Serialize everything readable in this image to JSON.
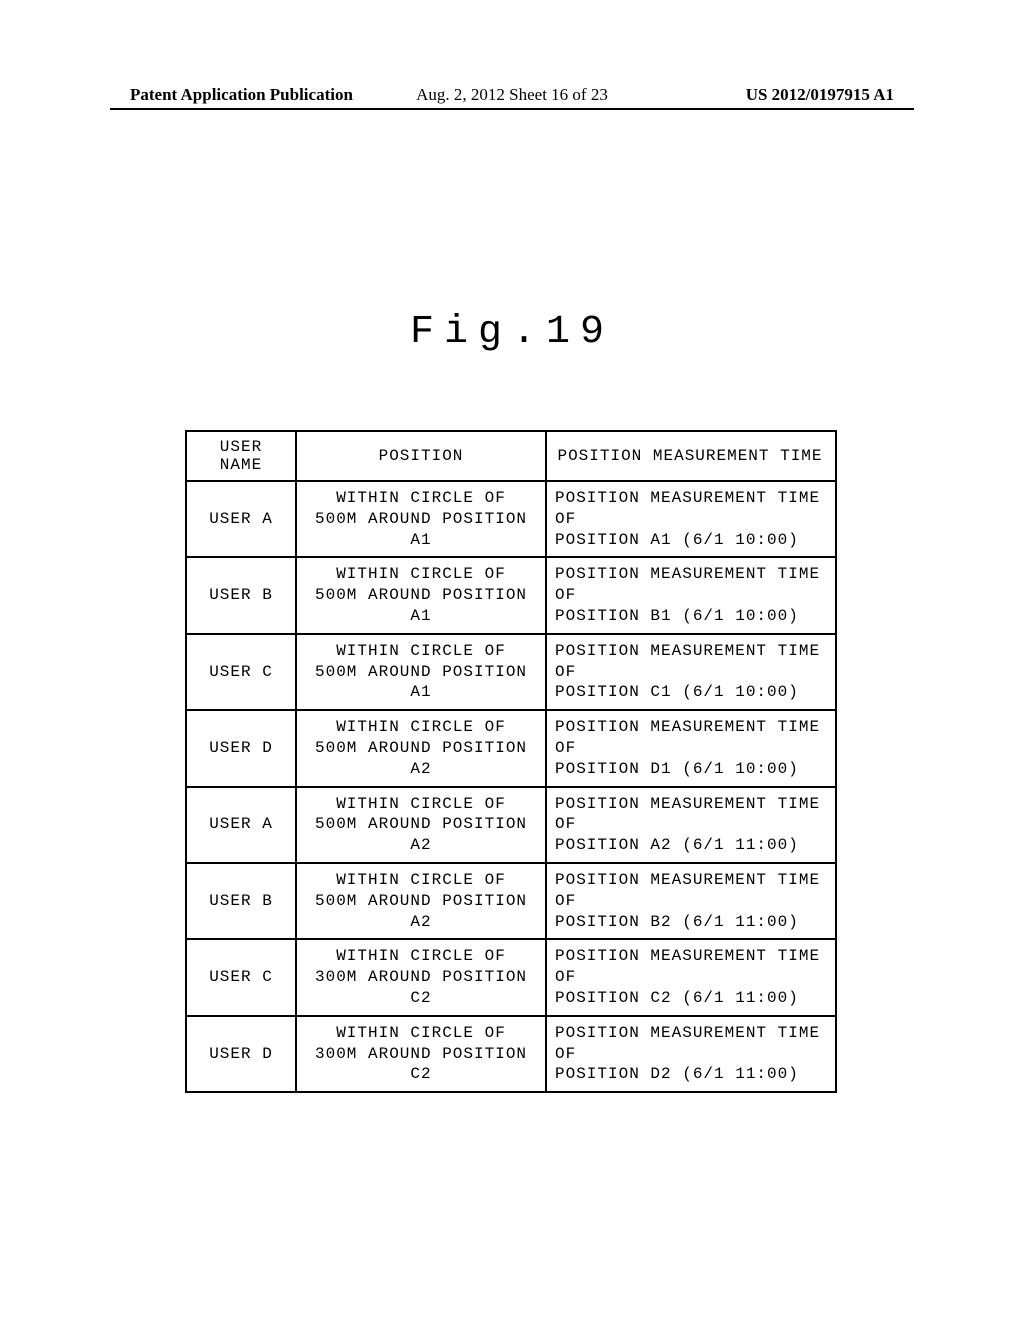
{
  "header": {
    "left": "Patent Application Publication",
    "center": "Aug. 2, 2012  Sheet 16 of 23",
    "right": "US 2012/0197915 A1"
  },
  "figure_label": "Fig.19",
  "table": {
    "headers": {
      "user": "USER NAME",
      "position": "POSITION",
      "time": "POSITION MEASUREMENT TIME"
    },
    "rows": [
      {
        "user": "USER A",
        "position": "WITHIN CIRCLE OF\n500M AROUND POSITION A1",
        "time": "POSITION MEASUREMENT TIME OF\nPOSITION A1 (6/1 10:00)"
      },
      {
        "user": "USER B",
        "position": "WITHIN CIRCLE OF\n500M AROUND POSITION A1",
        "time": "POSITION MEASUREMENT TIME OF\nPOSITION B1 (6/1 10:00)"
      },
      {
        "user": "USER C",
        "position": "WITHIN CIRCLE OF\n500M AROUND POSITION A1",
        "time": "POSITION MEASUREMENT TIME OF\nPOSITION C1 (6/1 10:00)"
      },
      {
        "user": "USER D",
        "position": "WITHIN CIRCLE OF\n500M AROUND POSITION A2",
        "time": "POSITION MEASUREMENT TIME OF\nPOSITION D1 (6/1 10:00)"
      },
      {
        "user": "USER A",
        "position": "WITHIN CIRCLE OF\n500M AROUND POSITION A2",
        "time": "POSITION MEASUREMENT TIME OF\nPOSITION A2 (6/1 11:00)"
      },
      {
        "user": "USER B",
        "position": "WITHIN CIRCLE OF\n500M AROUND POSITION A2",
        "time": "POSITION MEASUREMENT TIME OF\nPOSITION B2 (6/1 11:00)"
      },
      {
        "user": "USER C",
        "position": "WITHIN CIRCLE OF\n300M AROUND POSITION C2",
        "time": "POSITION MEASUREMENT TIME OF\nPOSITION C2 (6/1 11:00)"
      },
      {
        "user": "USER D",
        "position": "WITHIN CIRCLE OF\n300M AROUND POSITION C2",
        "time": "POSITION MEASUREMENT TIME OF\nPOSITION D2 (6/1 11:00)"
      }
    ]
  }
}
